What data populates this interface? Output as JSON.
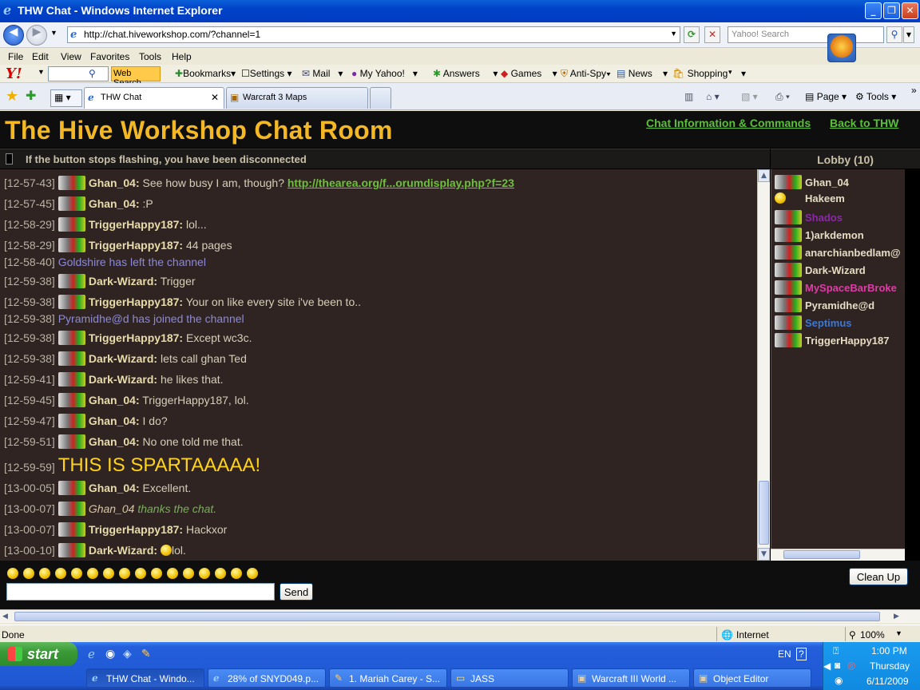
{
  "window": {
    "title": "THW Chat - Windows Internet Explorer"
  },
  "address": {
    "url": "http://chat.hiveworkshop.com/?channel=1",
    "search_placeholder": "Yahoo! Search"
  },
  "menu": [
    "File",
    "Edit",
    "View",
    "Favorites",
    "Tools",
    "Help"
  ],
  "yahoo_toolbar": {
    "web_search": "Web Search",
    "items": [
      "Bookmarks",
      "Settings",
      "Mail",
      "My Yahoo!",
      "Answers",
      "Games",
      "Anti-Spy",
      "News",
      "Shopping"
    ]
  },
  "tabs": [
    {
      "label": "THW Chat"
    },
    {
      "label": "Warcraft 3 Maps"
    }
  ],
  "toolbar_right": {
    "page": "Page",
    "tools": "Tools"
  },
  "page": {
    "title": "The Hive Workshop Chat Room",
    "link_info": "Chat Information & Commands",
    "link_back": "Back to THW",
    "notice": "If the button stops flashing, you have been disconnected",
    "lobby_title": "Lobby (10)"
  },
  "messages": [
    {
      "ts": "[12-57-43]",
      "nick": "Ghan_04:",
      "text": " See how busy I am, though? ",
      "link": "http://thearea.org/f...orumdisplay.php?f=23"
    },
    {
      "ts": "[12-57-45]",
      "nick": "Ghan_04:",
      "text": " :P"
    },
    {
      "ts": "[12-58-29]",
      "nick": "TriggerHappy187:",
      "text": " lol..."
    },
    {
      "ts": "[12-58-29]",
      "nick": "TriggerHappy187:",
      "text": " 44 pages"
    },
    {
      "ts": "[12-58-40]",
      "sys": "Goldshire has left the channel"
    },
    {
      "ts": "[12-59-38]",
      "nick": "Dark-Wizard:",
      "text": " Trigger"
    },
    {
      "ts": "[12-59-38]",
      "nick": "TriggerHappy187:",
      "text": " Your on like every site i've been to.."
    },
    {
      "ts": "[12-59-38]",
      "sys": "Pyramidhe@d has joined the channel"
    },
    {
      "ts": "[12-59-38]",
      "nick": "TriggerHappy187:",
      "text": " Except wc3c."
    },
    {
      "ts": "[12-59-38]",
      "nick": "Dark-Wizard:",
      "text": " lets call ghan Ted"
    },
    {
      "ts": "[12-59-41]",
      "nick": "Dark-Wizard:",
      "text": " he likes that."
    },
    {
      "ts": "[12-59-45]",
      "nick": "Ghan_04:",
      "text": " TriggerHappy187, lol."
    },
    {
      "ts": "[12-59-47]",
      "nick": "Ghan_04:",
      "text": " I do?"
    },
    {
      "ts": "[12-59-51]",
      "nick": "Ghan_04:",
      "text": " No one told me that."
    },
    {
      "ts": "[12-59-59]",
      "big": "THIS IS SPARTAAAAA!"
    },
    {
      "ts": "[13-00-05]",
      "nick": "Ghan_04:",
      "text": " Excellent."
    },
    {
      "ts": "[13-00-07]",
      "actnick": "Ghan_04",
      "action": " thanks the chat."
    },
    {
      "ts": "[13-00-07]",
      "nick": "TriggerHappy187:",
      "text": " Hackxor"
    },
    {
      "ts": "[13-00-10]",
      "nick": "Dark-Wizard:",
      "text": "lol."
    }
  ],
  "lobby_users": [
    {
      "name": "Ghan_04",
      "color": "#e6dcc4"
    },
    {
      "name": "Hakeem",
      "color": "#e6dcc4"
    },
    {
      "name": "Shados",
      "color": "#8a2aa8"
    },
    {
      "name": "1)arkdemon",
      "color": "#e6dcc4"
    },
    {
      "name": "anarchianbedlam@",
      "color": "#e6dcc4"
    },
    {
      "name": "Dark-Wizard",
      "color": "#e6dcc4"
    },
    {
      "name": "MySpaceBarBroke",
      "color": "#e03ca8"
    },
    {
      "name": "Pyramidhe@d",
      "color": "#e6dcc4"
    },
    {
      "name": "Septimus",
      "color": "#3a78d8"
    },
    {
      "name": "TriggerHappy187",
      "color": "#e6dcc4"
    }
  ],
  "controls": {
    "send": "Send",
    "cleanup": "Clean Up",
    "input_value": ""
  },
  "status": {
    "text": "Done",
    "zone": "Internet",
    "zoom": "100%"
  },
  "taskbar": {
    "start": "start",
    "buttons": [
      "THW Chat - Windo...",
      "28% of SNYD049.p...",
      "1. Mariah Carey - S...",
      "JASS",
      "Warcraft III World ...",
      "Object Editor"
    ],
    "lang": "EN",
    "time": "1:00 PM",
    "day": "Thursday",
    "date": "6/11/2009"
  },
  "colors": {
    "title_gold": "#f3b824",
    "link_green": "#5cbf3a",
    "chat_bg": "#2f2421"
  }
}
